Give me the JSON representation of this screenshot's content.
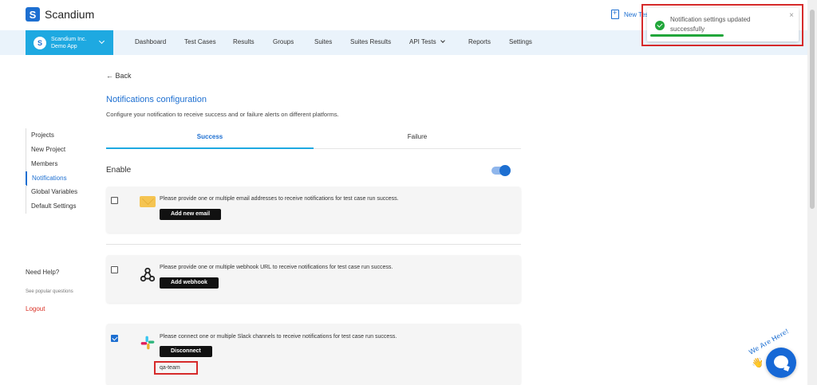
{
  "brand": {
    "logo_letter": "S",
    "name": "Scandium"
  },
  "header": {
    "new_test_label": "New Tes"
  },
  "project": {
    "avatar_letter": "S",
    "org": "Scandium Inc.",
    "app": "Demo App"
  },
  "nav": {
    "items": [
      "Dashboard",
      "Test Cases",
      "Results",
      "Groups",
      "Suites",
      "Suites Results",
      "API Tests",
      "Reports",
      "Settings"
    ]
  },
  "sidebar": {
    "items": [
      "Projects",
      "New Project",
      "Members",
      "Notifications",
      "Global Variables",
      "Default Settings"
    ],
    "active": "Notifications",
    "need_help": "Need Help?",
    "see_popular": "See popular questions",
    "logout": "Logout"
  },
  "main": {
    "back_label": "← Back",
    "title": "Notifications configuration",
    "description": "Configure your notification to receive success and or failure alerts on different platforms.",
    "tabs": {
      "success": "Success",
      "failure": "Failure"
    },
    "enable_label": "Enable",
    "enable_on": true,
    "email": {
      "checked": false,
      "desc": "Please provide one or multiple email addresses to receive notifications for test case run success.",
      "button": "Add new email"
    },
    "webhook": {
      "checked": false,
      "desc": "Please provide one or multiple webhook URL to receive notifications for test case run success.",
      "button": "Add webhook"
    },
    "slack": {
      "checked": true,
      "desc": "Please connect one or multiple Slack channels to receive notifications for test case run success.",
      "button": "Disconnect",
      "channel": "qa-team"
    }
  },
  "toast": {
    "message": "Notification settings updated successfully",
    "close": "×"
  },
  "chat": {
    "badge": "We Are Here!",
    "wave": "👋"
  },
  "colors": {
    "accent": "#1d6fd1",
    "cyan": "#1ea9e1",
    "success": "#21a63a",
    "highlight": "#d62a2a"
  }
}
